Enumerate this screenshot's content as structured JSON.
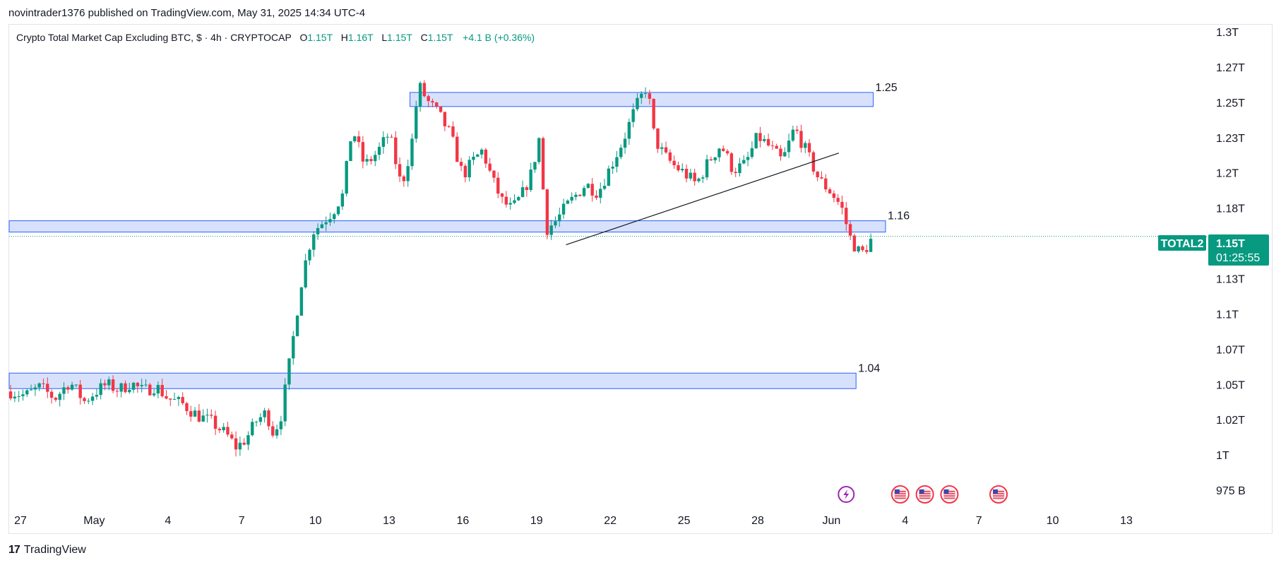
{
  "header": {
    "published": "novintrader1376 published on TradingView.com, May 31, 2025 14:34 UTC-4"
  },
  "legend": {
    "title": "Crypto Total Market Cap Excluding BTC, $ · 4h · CRYPTOCAP",
    "o_label": "O",
    "o_value": "1.15T",
    "h_label": "H",
    "h_value": "1.16T",
    "l_label": "L",
    "l_value": "1.15T",
    "c_label": "C",
    "c_value": "1.15T",
    "change": "+4.1 B (+0.36%)"
  },
  "price_tag": {
    "symbol": "TOTAL2",
    "price": "1.15T",
    "countdown": "01:25:55"
  },
  "footer": {
    "brand": "TradingView",
    "logo": "17"
  },
  "colors": {
    "up": "#089981",
    "down": "#f23645",
    "zone_fill": "#d1dcfb",
    "zone_border": "#2962ff",
    "trendline": "#131722",
    "price_line": "#089981"
  },
  "chart_data": {
    "type": "candlestick",
    "y_unit": "T",
    "ylim": [
      0.962,
      1.305
    ],
    "y_ticks": [
      {
        "value": 1.3,
        "label": "1.3T"
      },
      {
        "value": 1.275,
        "label": "1.27T"
      },
      {
        "value": 1.25,
        "label": "1.25T"
      },
      {
        "value": 1.225,
        "label": "1.23T"
      },
      {
        "value": 1.2,
        "label": "1.2T"
      },
      {
        "value": 1.175,
        "label": "1.18T"
      },
      {
        "value": 1.125,
        "label": "1.13T"
      },
      {
        "value": 1.1,
        "label": "1.1T"
      },
      {
        "value": 1.075,
        "label": "1.07T"
      },
      {
        "value": 1.05,
        "label": "1.05T"
      },
      {
        "value": 1.025,
        "label": "1.02T"
      },
      {
        "value": 1.0,
        "label": "1T"
      },
      {
        "value": 0.975,
        "label": "975 B"
      }
    ],
    "x_ticks": [
      "27",
      "May",
      "4",
      "7",
      "10",
      "13",
      "16",
      "19",
      "22",
      "25",
      "28",
      "Jun",
      "4",
      "7",
      "10",
      "13"
    ],
    "x_tick_days": [
      27,
      30,
      33,
      36,
      39,
      42,
      45,
      48,
      51,
      54,
      57,
      60,
      63,
      66,
      69,
      72
    ],
    "x_first_date": "Apr 27",
    "interval_hours": 4,
    "zones": [
      {
        "label": "1.25",
        "low": 1.247,
        "high": 1.257,
        "start_day": 42.85,
        "end_day": 61.7
      },
      {
        "label": "1.16",
        "low": 1.158,
        "high": 1.166,
        "start_day": 26.5,
        "end_day": 62.2
      },
      {
        "label": "1.04",
        "low": 1.047,
        "high": 1.058,
        "start_day": 26.5,
        "end_day": 61.0
      }
    ],
    "trendline": {
      "start": {
        "day": 49.2,
        "value": 1.149
      },
      "end": {
        "day": 60.3,
        "value": 1.214
      }
    },
    "last_price": 1.155,
    "event_icons": [
      {
        "day": 60.6,
        "kind": "lightning"
      },
      {
        "day": 62.8,
        "kind": "us-flag"
      },
      {
        "day": 63.8,
        "kind": "us-flag"
      },
      {
        "day": 64.8,
        "kind": "us-flag"
      },
      {
        "day": 66.8,
        "kind": "us-flag"
      }
    ],
    "close_path": [
      [
        26.6,
        1.045
      ],
      [
        27.2,
        1.042
      ],
      [
        27.8,
        1.048
      ],
      [
        28.4,
        1.04
      ],
      [
        29.0,
        1.052
      ],
      [
        29.6,
        1.038
      ],
      [
        30.0,
        1.044
      ],
      [
        30.5,
        1.05
      ],
      [
        31.0,
        1.046
      ],
      [
        31.5,
        1.051
      ],
      [
        32.0,
        1.045
      ],
      [
        32.5,
        1.049
      ],
      [
        33.0,
        1.04
      ],
      [
        33.6,
        1.036
      ],
      [
        34.2,
        1.028
      ],
      [
        34.8,
        1.023
      ],
      [
        35.4,
        1.014
      ],
      [
        35.8,
        1.005
      ],
      [
        36.2,
        1.012
      ],
      [
        36.6,
        1.024
      ],
      [
        37.0,
        1.03
      ],
      [
        37.3,
        1.015
      ],
      [
        37.6,
        1.028
      ],
      [
        37.9,
        1.06
      ],
      [
        38.2,
        1.095
      ],
      [
        38.5,
        1.13
      ],
      [
        38.9,
        1.158
      ],
      [
        39.3,
        1.165
      ],
      [
        39.7,
        1.172
      ],
      [
        40.1,
        1.184
      ],
      [
        40.5,
        1.232
      ],
      [
        41.0,
        1.205
      ],
      [
        41.5,
        1.214
      ],
      [
        42.0,
        1.228
      ],
      [
        42.5,
        1.19
      ],
      [
        42.9,
        1.218
      ],
      [
        43.2,
        1.262
      ],
      [
        43.6,
        1.25
      ],
      [
        44.0,
        1.242
      ],
      [
        44.5,
        1.227
      ],
      [
        45.0,
        1.198
      ],
      [
        45.4,
        1.208
      ],
      [
        45.8,
        1.216
      ],
      [
        46.2,
        1.195
      ],
      [
        46.6,
        1.18
      ],
      [
        47.0,
        1.174
      ],
      [
        47.4,
        1.184
      ],
      [
        47.8,
        1.2
      ],
      [
        48.1,
        1.224
      ],
      [
        48.4,
        1.16
      ],
      [
        48.8,
        1.166
      ],
      [
        49.2,
        1.176
      ],
      [
        49.6,
        1.184
      ],
      [
        50.0,
        1.192
      ],
      [
        50.5,
        1.186
      ],
      [
        51.0,
        1.204
      ],
      [
        51.5,
        1.222
      ],
      [
        52.0,
        1.245
      ],
      [
        52.5,
        1.262
      ],
      [
        52.8,
        1.224
      ],
      [
        53.2,
        1.212
      ],
      [
        53.6,
        1.205
      ],
      [
        54.0,
        1.2
      ],
      [
        54.5,
        1.192
      ],
      [
        55.0,
        1.208
      ],
      [
        55.5,
        1.22
      ],
      [
        56.0,
        1.202
      ],
      [
        56.5,
        1.206
      ],
      [
        57.0,
        1.226
      ],
      [
        57.5,
        1.218
      ],
      [
        58.0,
        1.208
      ],
      [
        58.5,
        1.232
      ],
      [
        59.0,
        1.214
      ],
      [
        59.5,
        1.195
      ],
      [
        60.0,
        1.186
      ],
      [
        60.4,
        1.176
      ],
      [
        60.8,
        1.152
      ],
      [
        61.2,
        1.142
      ],
      [
        61.5,
        1.149
      ],
      [
        61.7,
        1.155
      ]
    ],
    "seed": 7
  }
}
